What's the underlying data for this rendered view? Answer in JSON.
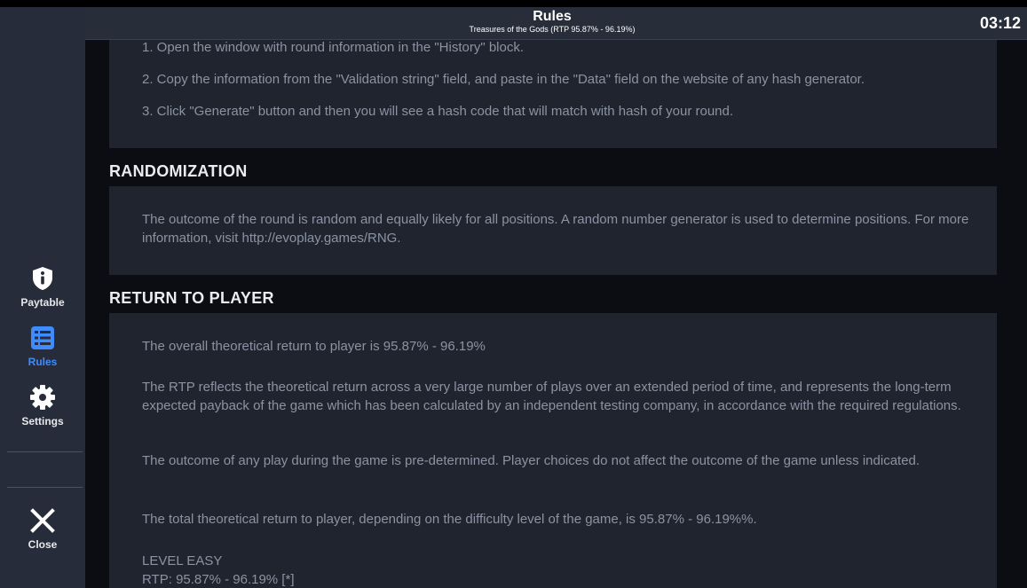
{
  "header": {
    "title": "Rules",
    "subtitle": "Treasures of the Gods (RTP 95.87% - 96.19%)",
    "clock": "03:12"
  },
  "sidebar": {
    "items": [
      {
        "label": "Paytable",
        "icon": "info-shield-icon",
        "active": false
      },
      {
        "label": "Rules",
        "icon": "list-icon",
        "active": true
      },
      {
        "label": "Settings",
        "icon": "gear-icon",
        "active": false
      }
    ],
    "close_label": "Close"
  },
  "colors": {
    "accent": "#3f8cff",
    "sidebar_bg": "#262c39",
    "panel_bg": "#1f242e",
    "page_bg": "#0b0d12",
    "body_text": "#8b93a3"
  },
  "hash": {
    "steps": [
      "1. Open the window with round information in the \"History\" block.",
      "2. Copy the information from the \"Validation string\" field, and paste in the \"Data\" field on the website of any hash generator.",
      "3. Click \"Generate\" button and then you will see a hash code that will match with hash of your round."
    ]
  },
  "randomization": {
    "title": "RANDOMIZATION",
    "text": "The outcome of the round is random and equally likely for all positions. A random number generator is used to determine positions. For more information, visit http://evoplay.games/RNG."
  },
  "rtp": {
    "title": "RETURN TO PLAYER",
    "p1": "The overall theoretical return to player is 95.87% - 96.19%",
    "p2": "The RTP reflects the theoretical return across a very large number of plays over an extended period of time, and represents the long-term expected payback of the game which has been calculated by an independent testing company, in accordance with the required regulations.",
    "p3": "The outcome of any play during the game is pre-determined. Player choices do not affect the outcome of the game unless indicated.",
    "p4": "The total theoretical return to player, depending on the difficulty level of the game, is 95.87% - 96.19%%.",
    "level_name": "LEVEL EASY",
    "level_rtp": "RTP: 95.87% - 96.19% [*]"
  }
}
